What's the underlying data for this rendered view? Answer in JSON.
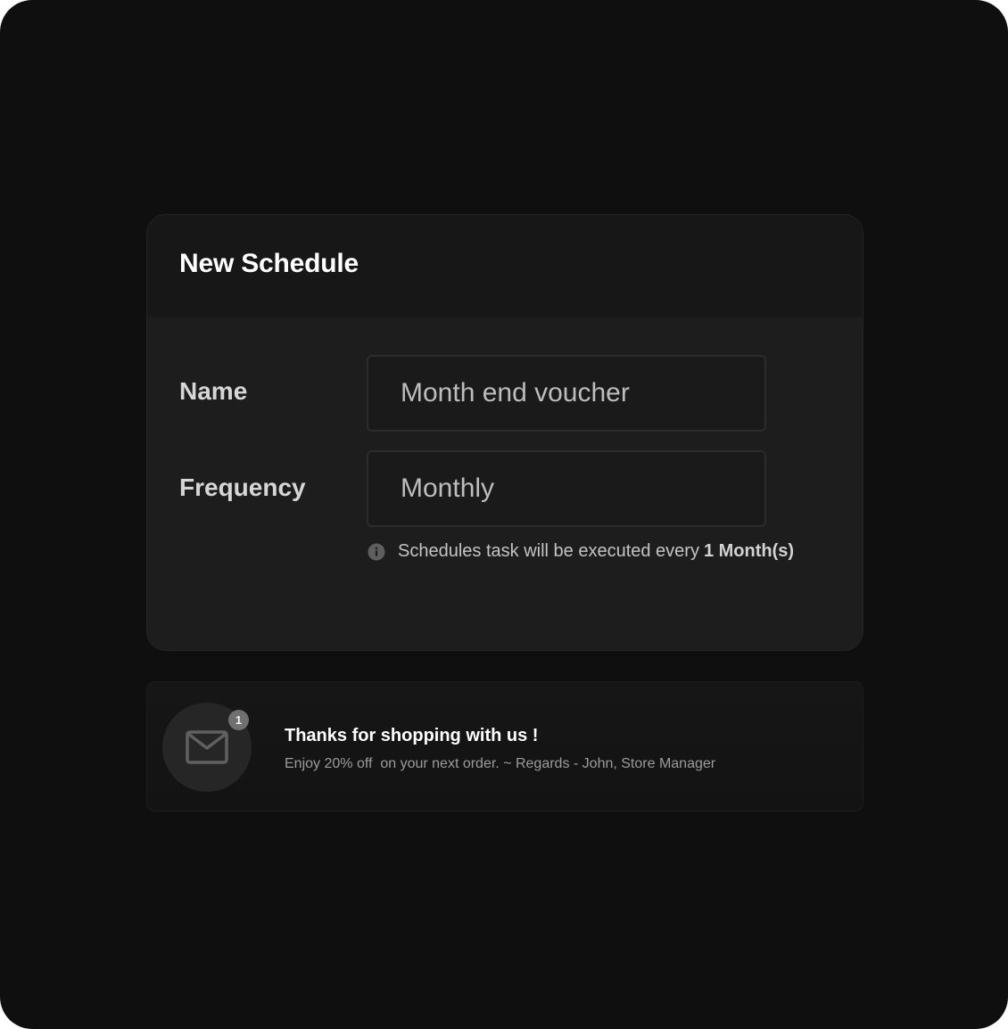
{
  "schedule_form": {
    "title": "New Schedule",
    "fields": {
      "name": {
        "label": "Name",
        "value": "Month end voucher"
      },
      "frequency": {
        "label": "Frequency",
        "value": "Monthly"
      }
    },
    "hint": {
      "icon": "info-icon",
      "text": "Schedules task will be executed every",
      "emphasis": "1 Month(s)"
    }
  },
  "notification": {
    "icon": "mail-icon",
    "badge_count": "1",
    "title": "Thanks for shopping with us !",
    "message": "Enjoy 20% off  on your next order. ~ Regards - John, Store Manager"
  },
  "colors": {
    "background": "#0f0f0f",
    "card": "#1d1d1d",
    "card_header": "#171717",
    "text_primary": "#ffffff",
    "text_muted": "#9c9c9c",
    "badge": "#707070"
  }
}
